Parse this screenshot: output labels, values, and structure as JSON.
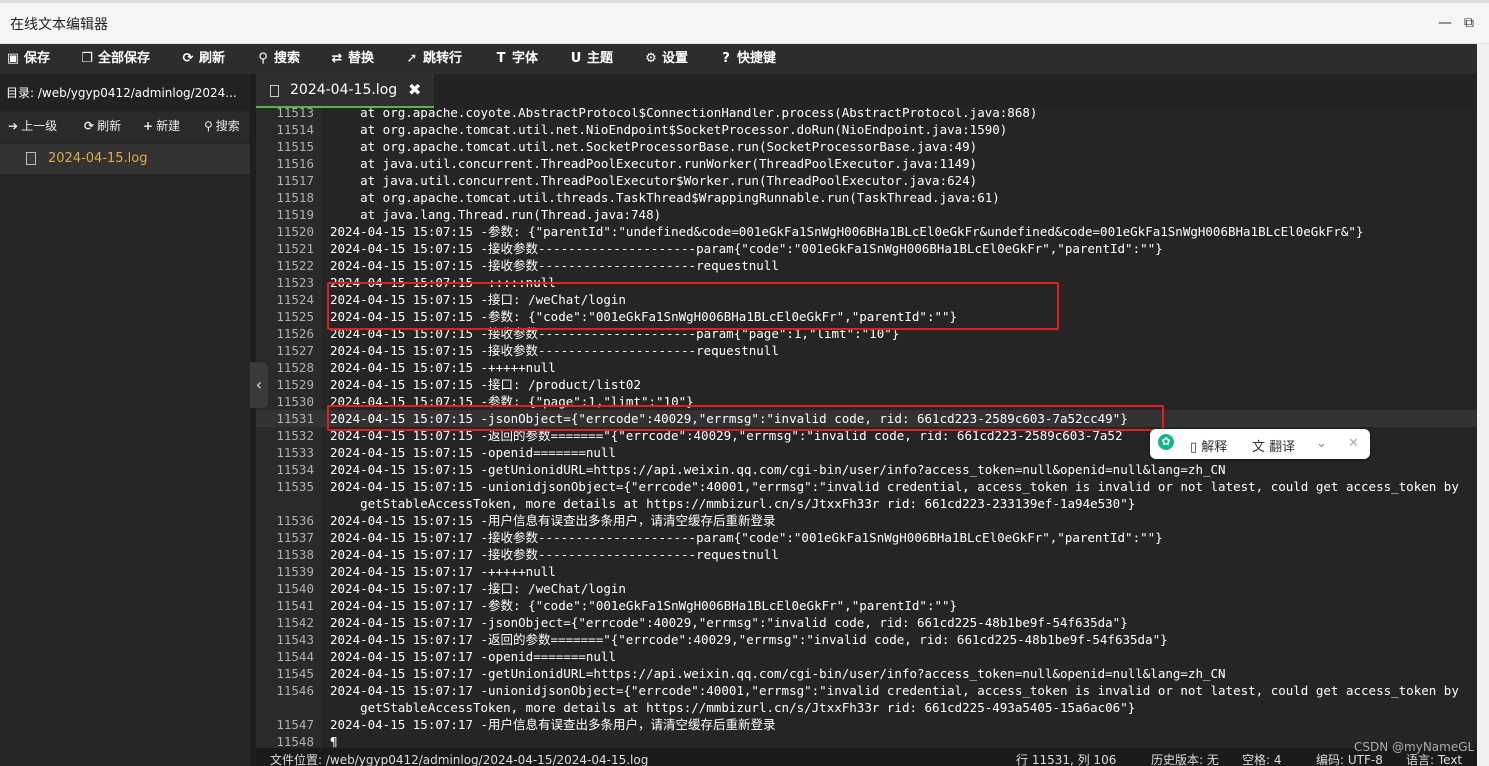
{
  "window": {
    "title": "在线文本编辑器",
    "minimize": "—",
    "maximize": "⧉"
  },
  "toolbar": [
    {
      "icon": "save-icon",
      "glyph": "▣",
      "label": "保存"
    },
    {
      "icon": "save-all-icon",
      "glyph": "❐",
      "label": "全部保存"
    },
    {
      "icon": "refresh-icon",
      "glyph": "⟳",
      "label": "刷新"
    },
    {
      "icon": "search-icon",
      "glyph": "⚲",
      "label": "搜索"
    },
    {
      "icon": "replace-icon",
      "glyph": "⇄",
      "label": "替换"
    },
    {
      "icon": "goto-line-icon",
      "glyph": "➚",
      "label": "跳转行"
    },
    {
      "icon": "font-icon",
      "glyph": "T",
      "label": "字体"
    },
    {
      "icon": "theme-icon",
      "glyph": "U",
      "label": "主题"
    },
    {
      "icon": "gear-icon",
      "glyph": "⚙",
      "label": "设置"
    },
    {
      "icon": "help-icon",
      "glyph": "?",
      "label": "快捷键"
    }
  ],
  "sidebar": {
    "path": "目录: /web/ygyp0412/adminlog/2024...",
    "actions": [
      {
        "icon": "arrow-up-icon",
        "glyph": "➔",
        "label": "上一级"
      },
      {
        "icon": "refresh-icon",
        "glyph": "⟳",
        "label": "刷新"
      },
      {
        "icon": "plus-icon",
        "glyph": "+",
        "label": "新建"
      },
      {
        "icon": "search-icon",
        "glyph": "⚲",
        "label": "搜索"
      }
    ],
    "files": [
      "2024-04-15.log"
    ],
    "collapse_glyph": "‹"
  },
  "tab": {
    "name": "2024-04-15.log",
    "close": "✖"
  },
  "editor": {
    "lines": [
      {
        "n": "11513",
        "t": "    at org.apache.coyote.AbstractProtocol$ConnectionHandler.process(AbstractProtocol.java:868)"
      },
      {
        "n": "11514",
        "t": "    at org.apache.tomcat.util.net.NioEndpoint$SocketProcessor.doRun(NioEndpoint.java:1590)"
      },
      {
        "n": "11515",
        "t": "    at org.apache.tomcat.util.net.SocketProcessorBase.run(SocketProcessorBase.java:49)"
      },
      {
        "n": "11516",
        "t": "    at java.util.concurrent.ThreadPoolExecutor.runWorker(ThreadPoolExecutor.java:1149)"
      },
      {
        "n": "11517",
        "t": "    at java.util.concurrent.ThreadPoolExecutor$Worker.run(ThreadPoolExecutor.java:624)"
      },
      {
        "n": "11518",
        "t": "    at org.apache.tomcat.util.threads.TaskThread$WrappingRunnable.run(TaskThread.java:61)"
      },
      {
        "n": "11519",
        "t": "    at java.lang.Thread.run(Thread.java:748)"
      },
      {
        "n": "11520",
        "t": "2024-04-15 15:07:15 -参数: {\"parentId\":\"undefined&code=001eGkFa1SnWgH006BHa1BLcEl0eGkFr&undefined&code=001eGkFa1SnWgH006BHa1BLcEl0eGkFr&\"}"
      },
      {
        "n": "11521",
        "t": "2024-04-15 15:07:15 -接收参数---------------------param{\"code\":\"001eGkFa1SnWgH006BHa1BLcEl0eGkFr\",\"parentId\":\"\"}"
      },
      {
        "n": "11522",
        "t": "2024-04-15 15:07:15 -接收参数---------------------requestnull"
      },
      {
        "n": "11523",
        "t": "2024-04-15 15:07:15 -:::::null"
      },
      {
        "n": "11524",
        "t": "2024-04-15 15:07:15 -接口: /weChat/login"
      },
      {
        "n": "11525",
        "t": "2024-04-15 15:07:15 -参数: {\"code\":\"001eGkFa1SnWgH006BHa1BLcEl0eGkFr\",\"parentId\":\"\"}"
      },
      {
        "n": "11526",
        "t": "2024-04-15 15:07:15 -接收参数---------------------param{\"page\":1,\"limt\":\"10\"}"
      },
      {
        "n": "11527",
        "t": "2024-04-15 15:07:15 -接收参数---------------------requestnull"
      },
      {
        "n": "11528",
        "t": "2024-04-15 15:07:15 -+++++null"
      },
      {
        "n": "11529",
        "t": "2024-04-15 15:07:15 -接口: /product/list02"
      },
      {
        "n": "11530",
        "t": "2024-04-15 15:07:15 -参数: {\"page\":1,\"limt\":\"10\"}"
      },
      {
        "n": "11531",
        "t": "2024-04-15 15:07:15 -jsonObject={\"errcode\":40029,\"errmsg\":\"invalid code, rid: 661cd223-2589c603-7a52cc49\"}"
      },
      {
        "n": "11532",
        "t": "2024-04-15 15:07:15 -返回的参数=======\"{\"errcode\":40029,\"errmsg\":\"invalid code, rid: 661cd223-2589c603-7a52"
      },
      {
        "n": "11533",
        "t": "2024-04-15 15:07:15 -openid=======null"
      },
      {
        "n": "11534",
        "t": "2024-04-15 15:07:15 -getUnionidURL=https://api.weixin.qq.com/cgi-bin/user/info?access_token=null&openid=null&lang=zh_CN"
      },
      {
        "n": "11535",
        "t": "2024-04-15 15:07:15 -unionidjsonObject={\"errcode\":40001,\"errmsg\":\"invalid credential, access_token is invalid or not latest, could get access_token by"
      },
      {
        "n": "",
        "t": "    getStableAccessToken, more details at https://mmbizurl.cn/s/JtxxFh33r rid: 661cd223-233139ef-1a94e530\"}"
      },
      {
        "n": "11536",
        "t": "2024-04-15 15:07:15 -用户信息有误查出多条用户，请清空缓存后重新登录"
      },
      {
        "n": "11537",
        "t": "2024-04-15 15:07:17 -接收参数---------------------param{\"code\":\"001eGkFa1SnWgH006BHa1BLcEl0eGkFr\",\"parentId\":\"\"}"
      },
      {
        "n": "11538",
        "t": "2024-04-15 15:07:17 -接收参数---------------------requestnull"
      },
      {
        "n": "11539",
        "t": "2024-04-15 15:07:17 -+++++null"
      },
      {
        "n": "11540",
        "t": "2024-04-15 15:07:17 -接口: /weChat/login"
      },
      {
        "n": "11541",
        "t": "2024-04-15 15:07:17 -参数: {\"code\":\"001eGkFa1SnWgH006BHa1BLcEl0eGkFr\",\"parentId\":\"\"}"
      },
      {
        "n": "11542",
        "t": "2024-04-15 15:07:17 -jsonObject={\"errcode\":40029,\"errmsg\":\"invalid code, rid: 661cd225-48b1be9f-54f635da\"}"
      },
      {
        "n": "11543",
        "t": "2024-04-15 15:07:17 -返回的参数=======\"{\"errcode\":40029,\"errmsg\":\"invalid code, rid: 661cd225-48b1be9f-54f635da\"}"
      },
      {
        "n": "11544",
        "t": "2024-04-15 15:07:17 -openid=======null"
      },
      {
        "n": "11545",
        "t": "2024-04-15 15:07:17 -getUnionidURL=https://api.weixin.qq.com/cgi-bin/user/info?access_token=null&openid=null&lang=zh_CN"
      },
      {
        "n": "11546",
        "t": "2024-04-15 15:07:17 -unionidjsonObject={\"errcode\":40001,\"errmsg\":\"invalid credential, access_token is invalid or not latest, could get access_token by"
      },
      {
        "n": "",
        "t": "    getStableAccessToken, more details at https://mmbizurl.cn/s/JtxxFh33r rid: 661cd225-493a5405-15a6ac06\"}"
      },
      {
        "n": "11547",
        "t": "2024-04-15 15:07:17 -用户信息有误查出多条用户，请清空缓存后重新登录"
      },
      {
        "n": "11548",
        "t": "¶"
      }
    ],
    "active_line": "11531"
  },
  "popup": {
    "explain": "解释",
    "translate": "翻译",
    "more": "⌄",
    "close": "✕"
  },
  "status": {
    "file_location": "文件位置: /web/ygyp0412/adminlog/2024-04-15/2024-04-15.log",
    "cursor": "行 11531, 列 106",
    "history": "历史版本: 无",
    "spaces": "空格: 4",
    "encoding": "编码: UTF-8",
    "language": "语言: Text"
  },
  "watermark": "CSDN @myNameGL"
}
